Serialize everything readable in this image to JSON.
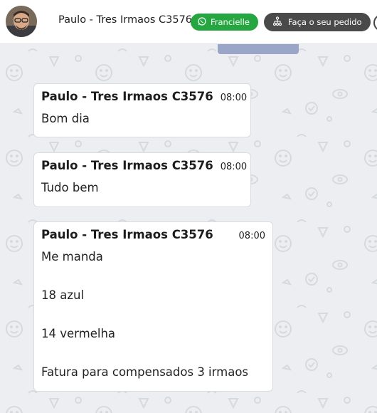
{
  "header": {
    "contact_name": "Paulo - Tres Irmaos C3576",
    "agent_badge": "Francielle",
    "order_button": "Faça o seu pedido",
    "colors": {
      "agent_green": "#25a640",
      "order_dark": "#4a4a4a"
    }
  },
  "messages": [
    {
      "sender": "Paulo - Tres Irmaos C3576",
      "time": "08:00",
      "lines": [
        "Bom dia"
      ]
    },
    {
      "sender": "Paulo - Tres Irmaos C3576",
      "time": "08:00",
      "lines": [
        "Tudo bem"
      ]
    },
    {
      "sender": "Paulo - Tres Irmaos C3576",
      "time": "08:00",
      "lines": [
        "Me manda",
        "",
        "18 azul",
        "",
        "14 vermelha",
        "",
        "Fatura para compensados 3 irmaos"
      ]
    }
  ]
}
